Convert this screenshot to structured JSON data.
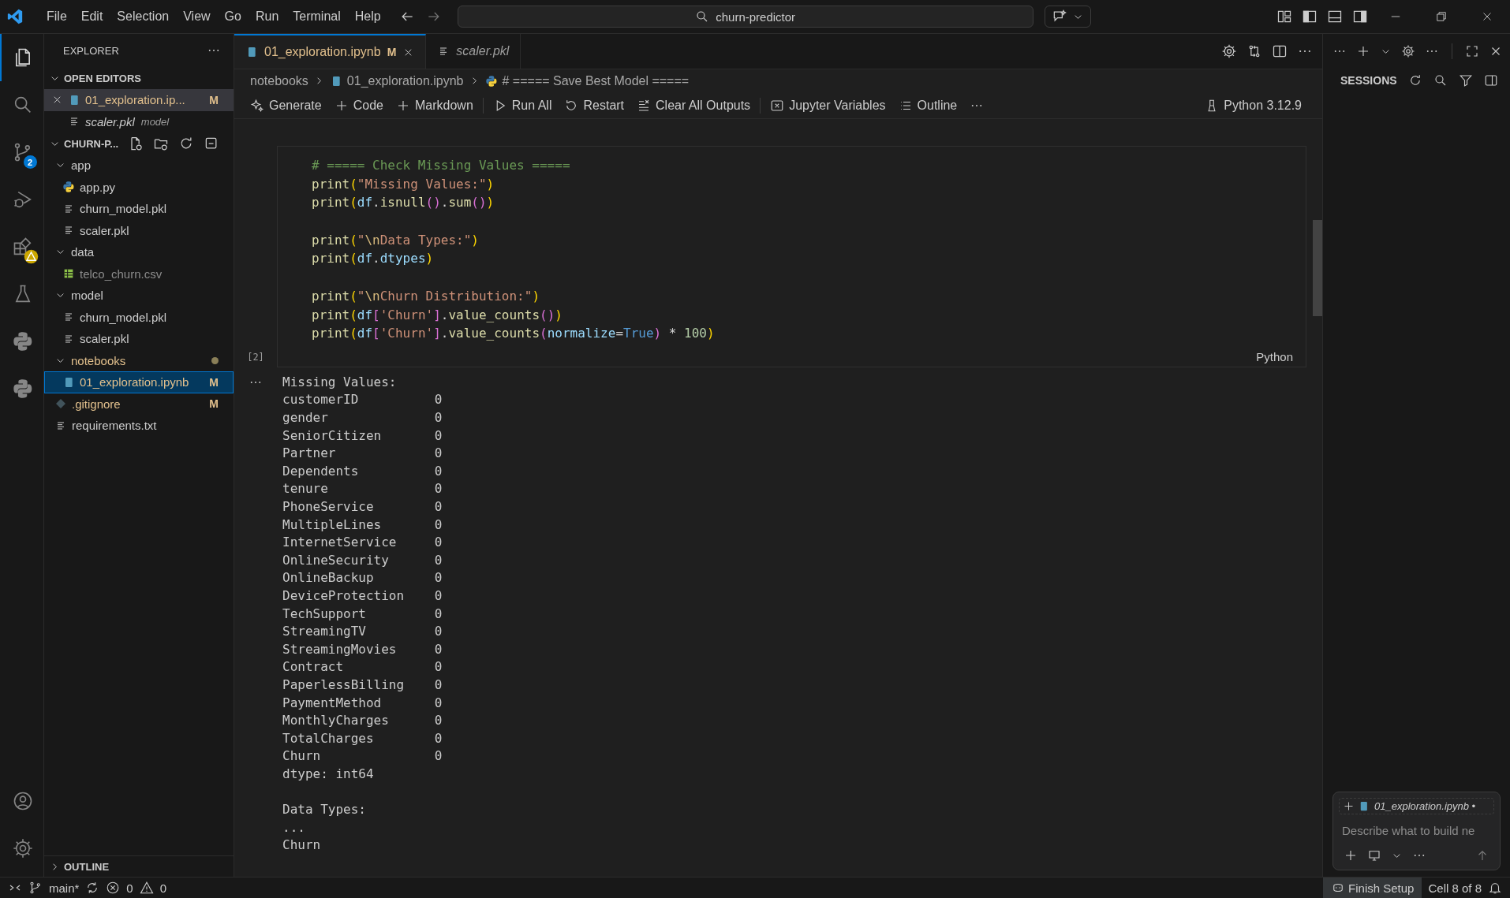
{
  "title_bar": {
    "menu": [
      "File",
      "Edit",
      "Selection",
      "View",
      "Go",
      "Run",
      "Terminal",
      "Help"
    ],
    "search": "churn-predictor"
  },
  "activity_bar": {
    "items": [
      {
        "kind": "files",
        "selected": true,
        "warning": false
      },
      {
        "kind": "search",
        "selected": false,
        "warning": false
      },
      {
        "kind": "branch",
        "selected": false,
        "warning": false,
        "badge": "2"
      },
      {
        "kind": "bugplay",
        "selected": false,
        "warning": false
      },
      {
        "kind": "blocks",
        "selected": false,
        "warning": true
      },
      {
        "kind": "flask",
        "selected": false,
        "warning": false
      },
      {
        "kind": "python",
        "selected": false,
        "warning": false
      },
      {
        "kind": "python",
        "selected": false,
        "warning": false
      }
    ],
    "bottom": [
      {
        "kind": "account"
      },
      {
        "kind": "gear"
      }
    ]
  },
  "sidebar": {
    "title": "EXPLORER",
    "open_editors": {
      "title": "OPEN EDITORS",
      "expanded": true,
      "items": [
        {
          "name": "01_exploration.ip...",
          "kind": "notebook",
          "badge": "M",
          "modified": true,
          "preview": false,
          "selected": true
        },
        {
          "name": "scaler.pkl",
          "kind": "text",
          "description": "model",
          "modified": false,
          "preview": true,
          "selected": false
        }
      ]
    },
    "project": {
      "title": "CHURN-P...",
      "expanded": true,
      "tree": [
        {
          "name": "app",
          "kind": "folder",
          "expanded": true,
          "modified": false,
          "ignored": false,
          "selected": false,
          "children": [
            {
              "name": "app.py",
              "kind": "python",
              "modified": false,
              "ignored": false,
              "selected": false
            },
            {
              "name": "churn_model.pkl",
              "kind": "text",
              "modified": false,
              "ignored": false,
              "selected": false
            },
            {
              "name": "scaler.pkl",
              "kind": "text",
              "modified": false,
              "ignored": false,
              "selected": false
            }
          ]
        },
        {
          "name": "data",
          "kind": "folder",
          "expanded": true,
          "modified": false,
          "ignored": false,
          "selected": false,
          "children": [
            {
              "name": "telco_churn.csv",
              "kind": "csv",
              "modified": false,
              "ignored": true,
              "selected": false
            }
          ]
        },
        {
          "name": "model",
          "kind": "folder",
          "expanded": true,
          "modified": false,
          "ignored": false,
          "selected": false,
          "children": [
            {
              "name": "churn_model.pkl",
              "kind": "text",
              "modified": false,
              "ignored": false,
              "selected": false
            },
            {
              "name": "scaler.pkl",
              "kind": "text",
              "modified": false,
              "ignored": false,
              "selected": false
            }
          ]
        },
        {
          "name": "notebooks",
          "kind": "folder",
          "expanded": true,
          "modified": true,
          "ignored": false,
          "selected": false,
          "children": [
            {
              "name": "01_exploration.ipynb",
              "kind": "notebook",
              "badge": "M",
              "modified": true,
              "ignored": false,
              "selected": true
            }
          ]
        },
        {
          "name": ".gitignore",
          "kind": "git",
          "badge": "M",
          "modified": true,
          "ignored": false,
          "selected": false
        },
        {
          "name": "requirements.txt",
          "kind": "text",
          "modified": false,
          "ignored": false,
          "selected": false
        }
      ]
    },
    "outline": {
      "title": "OUTLINE",
      "expanded": false
    }
  },
  "tabs": [
    {
      "label": "01_exploration.ipynb",
      "kind": "notebook",
      "badge": "M",
      "preview": false,
      "selected": true
    },
    {
      "label": "scaler.pkl",
      "kind": "text",
      "preview": true,
      "selected": false
    }
  ],
  "breadcrumb": [
    {
      "label": "notebooks",
      "kind": "folder"
    },
    {
      "label": "01_exploration.ipynb",
      "kind": "notebook"
    },
    {
      "label": "# ===== Save Best Model =====",
      "kind": "python"
    }
  ],
  "toolbar": {
    "groups": [
      [
        {
          "label": "Generate",
          "kind": "sparkle"
        },
        {
          "label": "Code",
          "kind": "plus"
        },
        {
          "label": "Markdown",
          "kind": "plus"
        }
      ],
      [
        {
          "label": "Run All",
          "kind": "run"
        },
        {
          "label": "Restart",
          "kind": "restart"
        },
        {
          "label": "Clear All Outputs",
          "kind": "clear"
        }
      ],
      [
        {
          "label": "Jupyter Variables",
          "kind": "variables"
        },
        {
          "label": "Outline",
          "kind": "outline"
        }
      ]
    ],
    "kernel": "Python 3.12.9"
  },
  "cell": {
    "execution_count": "[2]",
    "language": "Python",
    "code": [
      [
        [
          {
            "t": "# ===== Check Missing Values =====",
            "kind": "cm"
          }
        ],
        [
          {
            "t": "print",
            "kind": "fn"
          },
          {
            "t": "(",
            "kind": "p1"
          },
          {
            "t": "\"Missing Values:\"",
            "kind": "str"
          },
          {
            "t": ")",
            "kind": "p1"
          }
        ],
        [
          {
            "t": "print",
            "kind": "fn"
          },
          {
            "t": "(",
            "kind": "p1"
          },
          {
            "t": "df",
            "kind": "var"
          },
          {
            "t": ".",
            "kind": "op"
          },
          {
            "t": "isnull",
            "kind": "fn"
          },
          {
            "t": "()",
            "kind": "p2"
          },
          {
            "t": ".",
            "kind": "op"
          },
          {
            "t": "sum",
            "kind": "fn"
          },
          {
            "t": "()",
            "kind": "p2"
          },
          {
            "t": ")",
            "kind": "p1"
          }
        ]
      ],
      [
        [
          {
            "t": "print",
            "kind": "fn"
          },
          {
            "t": "(",
            "kind": "p1"
          },
          {
            "t": "\"",
            "kind": "str"
          },
          {
            "t": "\\n",
            "kind": "esc"
          },
          {
            "t": "Data Types:\"",
            "kind": "str"
          },
          {
            "t": ")",
            "kind": "p1"
          }
        ],
        [
          {
            "t": "print",
            "kind": "fn"
          },
          {
            "t": "(",
            "kind": "p1"
          },
          {
            "t": "df",
            "kind": "var"
          },
          {
            "t": ".",
            "kind": "op"
          },
          {
            "t": "dtypes",
            "kind": "var"
          },
          {
            "t": ")",
            "kind": "p1"
          }
        ]
      ],
      [
        [
          {
            "t": "print",
            "kind": "fn"
          },
          {
            "t": "(",
            "kind": "p1"
          },
          {
            "t": "\"",
            "kind": "str"
          },
          {
            "t": "\\n",
            "kind": "esc"
          },
          {
            "t": "Churn Distribution:\"",
            "kind": "str"
          },
          {
            "t": ")",
            "kind": "p1"
          }
        ],
        [
          {
            "t": "print",
            "kind": "fn"
          },
          {
            "t": "(",
            "kind": "p1"
          },
          {
            "t": "df",
            "kind": "var"
          },
          {
            "t": "[",
            "kind": "p2"
          },
          {
            "t": "'Churn'",
            "kind": "str"
          },
          {
            "t": "]",
            "kind": "p2"
          },
          {
            "t": ".",
            "kind": "op"
          },
          {
            "t": "value_counts",
            "kind": "fn"
          },
          {
            "t": "()",
            "kind": "p2"
          },
          {
            "t": ")",
            "kind": "p1"
          }
        ],
        [
          {
            "t": "print",
            "kind": "fn"
          },
          {
            "t": "(",
            "kind": "p1"
          },
          {
            "t": "df",
            "kind": "var"
          },
          {
            "t": "[",
            "kind": "p2"
          },
          {
            "t": "'Churn'",
            "kind": "str"
          },
          {
            "t": "]",
            "kind": "p2"
          },
          {
            "t": ".",
            "kind": "op"
          },
          {
            "t": "value_counts",
            "kind": "fn"
          },
          {
            "t": "(",
            "kind": "p2"
          },
          {
            "t": "normalize",
            "kind": "var"
          },
          {
            "t": "=",
            "kind": "op"
          },
          {
            "t": "True",
            "kind": "kw"
          },
          {
            "t": ")",
            "kind": "p2"
          },
          {
            "t": " * ",
            "kind": "op"
          },
          {
            "t": "100",
            "kind": "num"
          },
          {
            "t": ")",
            "kind": "p1"
          }
        ]
      ]
    ],
    "output": [
      [
        "Missing Values:",
        "customerID          0",
        "gender              0",
        "SeniorCitizen       0",
        "Partner             0",
        "Dependents          0",
        "tenure              0",
        "PhoneService        0",
        "MultipleLines       0",
        "InternetService     0",
        "OnlineSecurity      0",
        "OnlineBackup        0",
        "DeviceProtection    0",
        "TechSupport         0",
        "StreamingTV         0",
        "StreamingMovies     0",
        "Contract            0",
        "PaperlessBilling    0",
        "PaymentMethod       0",
        "MonthlyCharges      0",
        "TotalCharges        0",
        "Churn               0",
        "dtype: int64"
      ],
      [
        "Data Types:",
        "...",
        "Churn"
      ]
    ]
  },
  "secondary_sidebar": {
    "title": "SESSIONS",
    "chat": {
      "context": "01_exploration.ipynb •",
      "placeholder": "Describe what to build ne"
    }
  },
  "status_bar": {
    "branch": "main*",
    "errors": "0",
    "warnings": "0",
    "finish_setup": "Finish Setup",
    "cell_position": "Cell 8 of 8"
  }
}
